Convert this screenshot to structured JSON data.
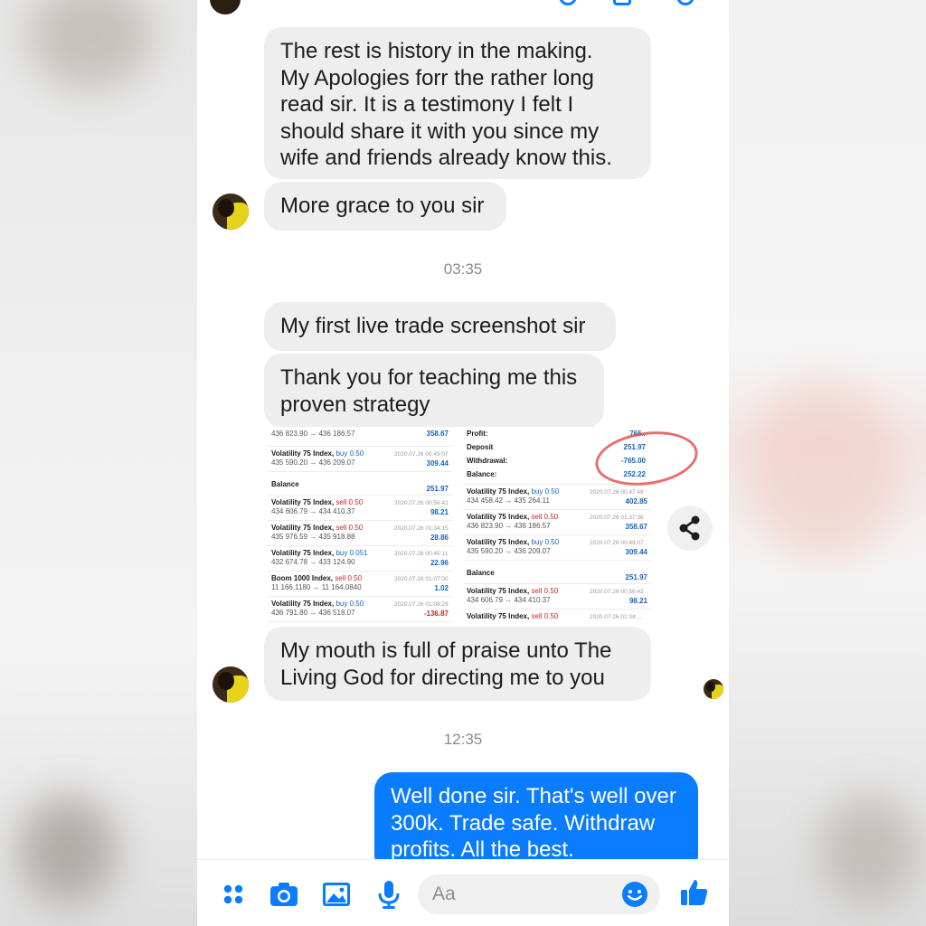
{
  "conversation": {
    "messages": [
      {
        "text": "The rest is history in the making.\nMy Apologies forr the rather long\nread sir. It is a testimony  I felt I\nshould share it with you since my\nwife and friends already know this."
      },
      {
        "text": "More grace to you sir"
      },
      {
        "text": "My first live trade screenshot sir"
      },
      {
        "text": "Thank you for teaching me this\nproven strategy"
      },
      {
        "text": "My mouth is full of praise unto The\nLiving God for directing me to you"
      },
      {
        "text": "Well done sir. That's well over\n300k. Trade safe. Withdraw\nprofits. All the best."
      }
    ],
    "timestamps": [
      "03:35",
      "12:35"
    ]
  },
  "trade_screenshot": {
    "left_rows": [
      {
        "l2": "436 823.90 → 436 186.57",
        "amt": "358.67"
      },
      {
        "name": "Volatility 75 Index,",
        "side": "buy 0.50",
        "dt": "2020.07.26 00:49:07",
        "l2": "435 590.20 → 436 209.07",
        "amt": "309.44"
      },
      {
        "name": "Balance",
        "amt": "251.97"
      },
      {
        "name": "Volatility 75 Index,",
        "side": "sell 0.50",
        "dt": "2020.07.26 00:56:42",
        "l2": "434 606.79 → 434 410.37",
        "amt": "98.21"
      },
      {
        "name": "Volatility 75 Index,",
        "side": "sell 0.50",
        "dt": "2020.07.26 01:34:15",
        "l2": "435 976.59 → 435 918.88",
        "amt": "28.86"
      },
      {
        "name": "Volatility 75 Index,",
        "side": "buy 0.051",
        "dt": "2020.07.26 00:45:11",
        "l2": "432 674.78 → 433 124.90",
        "amt": "22.96"
      },
      {
        "name": "Boom 1000 Index,",
        "side": "sell 0.50",
        "dt": "2020.07.26 01:07:00",
        "l2": "11 166.1180 → 11 164.0840",
        "amt": "1.02"
      },
      {
        "name": "Volatility 75 Index,",
        "side": "buy 0.50",
        "dt": "2020.07.26 01:08:29",
        "l2": "436 791.80 → 436 518.07",
        "amt": "-136.87"
      }
    ],
    "summary": [
      {
        "k": "Profit:",
        "v": "765.."
      },
      {
        "k": "Deposit",
        "v": "251.97"
      },
      {
        "k": "Withdrawal:",
        "v": "-765.00"
      },
      {
        "k": "Balance:",
        "v": "252.22"
      }
    ],
    "right_rows": [
      {
        "name": "Volatility 75 Index,",
        "side": "buy 0.50",
        "dt": "2020.07.26 00:47:48",
        "l2": "434 458.42 → 435 264.11",
        "amt": "402.85"
      },
      {
        "name": "Volatility 75 Index,",
        "side": "sell 0.50",
        "dt": "2020.07.26 01:37:36",
        "l2": "436 823.90 → 436 186.57",
        "amt": "358.67"
      },
      {
        "name": "Volatility 75 Index,",
        "side": "buy 0.50",
        "dt": "2020.07.26 00:49:07",
        "l2": "435 590.20 → 436 209.07",
        "amt": "309.44"
      },
      {
        "name": "Balance",
        "amt": "251.97"
      },
      {
        "name": "Volatility 75 Index,",
        "side": "sell 0.50",
        "dt": "2020.07.26 00:56:42",
        "l2": "434 606.79 → 434 410.37",
        "amt": "98.21"
      },
      {
        "name": "Volatility 75 Index,",
        "side": "sell 0.50",
        "dt": "2020.07.26 01:34:..."
      }
    ]
  },
  "composer": {
    "placeholder": "Aa",
    "icons": [
      "grid-icon",
      "camera-icon",
      "image-icon",
      "microphone-icon",
      "emoji-icon",
      "thumbs-up-icon"
    ]
  },
  "colors": {
    "accent": "#0a7cff",
    "incoming_bubble": "#eeeeee",
    "timestamp": "#8a8a8a"
  }
}
